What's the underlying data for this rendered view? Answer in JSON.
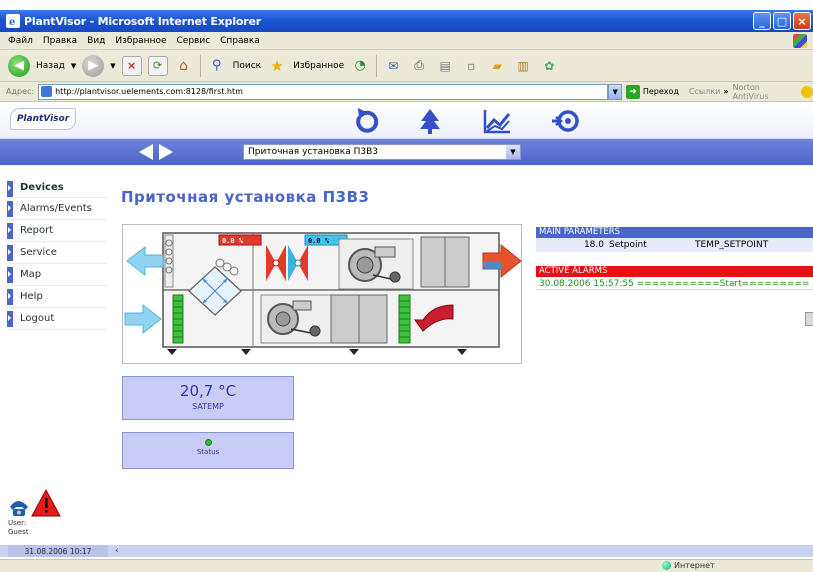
{
  "window": {
    "title": "PlantVisor - Microsoft Internet Explorer"
  },
  "menu": {
    "items": [
      "Файл",
      "Правка",
      "Вид",
      "Избранное",
      "Сервис",
      "Справка"
    ]
  },
  "toolbar": {
    "back_label": "Назад",
    "search_label": "Поиск",
    "favorites_label": "Избранное"
  },
  "address": {
    "label": "Адрес:",
    "url": "http://plantvisor.uelements.com:8128/first.htm",
    "go_label": "Переход",
    "links_label": "Ссылки",
    "norton_label": "Norton AntiVirus"
  },
  "app": {
    "logo": "PlantVisor"
  },
  "nav": {
    "device_select": "Приточная установка П3В3"
  },
  "sidebar": {
    "items": [
      {
        "label": "Devices"
      },
      {
        "label": "Alarms/Events"
      },
      {
        "label": "Report"
      },
      {
        "label": "Service"
      },
      {
        "label": "Map"
      },
      {
        "label": "Help"
      },
      {
        "label": "Logout"
      }
    ],
    "user_label": "User:",
    "user_name": "Guest"
  },
  "main": {
    "title": "Приточная установка П3В3",
    "damper_1": "0.0 %",
    "damper_2": "0.0 %",
    "temperature": {
      "value": "20,7 °C",
      "label": "SATEMP"
    },
    "status": {
      "label": "Status"
    }
  },
  "main_parameters": {
    "header": "MAIN PARAMETERS",
    "rows": [
      {
        "value": "18.0",
        "name": "Setpoint",
        "code": "TEMP_SETPOINT"
      }
    ]
  },
  "active_alarms": {
    "header": "ACTIVE ALARMS",
    "rows": [
      {
        "text": "30.08.2006 15:57:55  ===========Start========="
      }
    ]
  },
  "footer": {
    "datetime": "31.08.2006 10:17"
  },
  "statusbar": {
    "zone": "Интернет"
  },
  "colors": {
    "accent": "#4c66c8",
    "alarm": "#e81010",
    "panel": "#c9ccf4"
  }
}
